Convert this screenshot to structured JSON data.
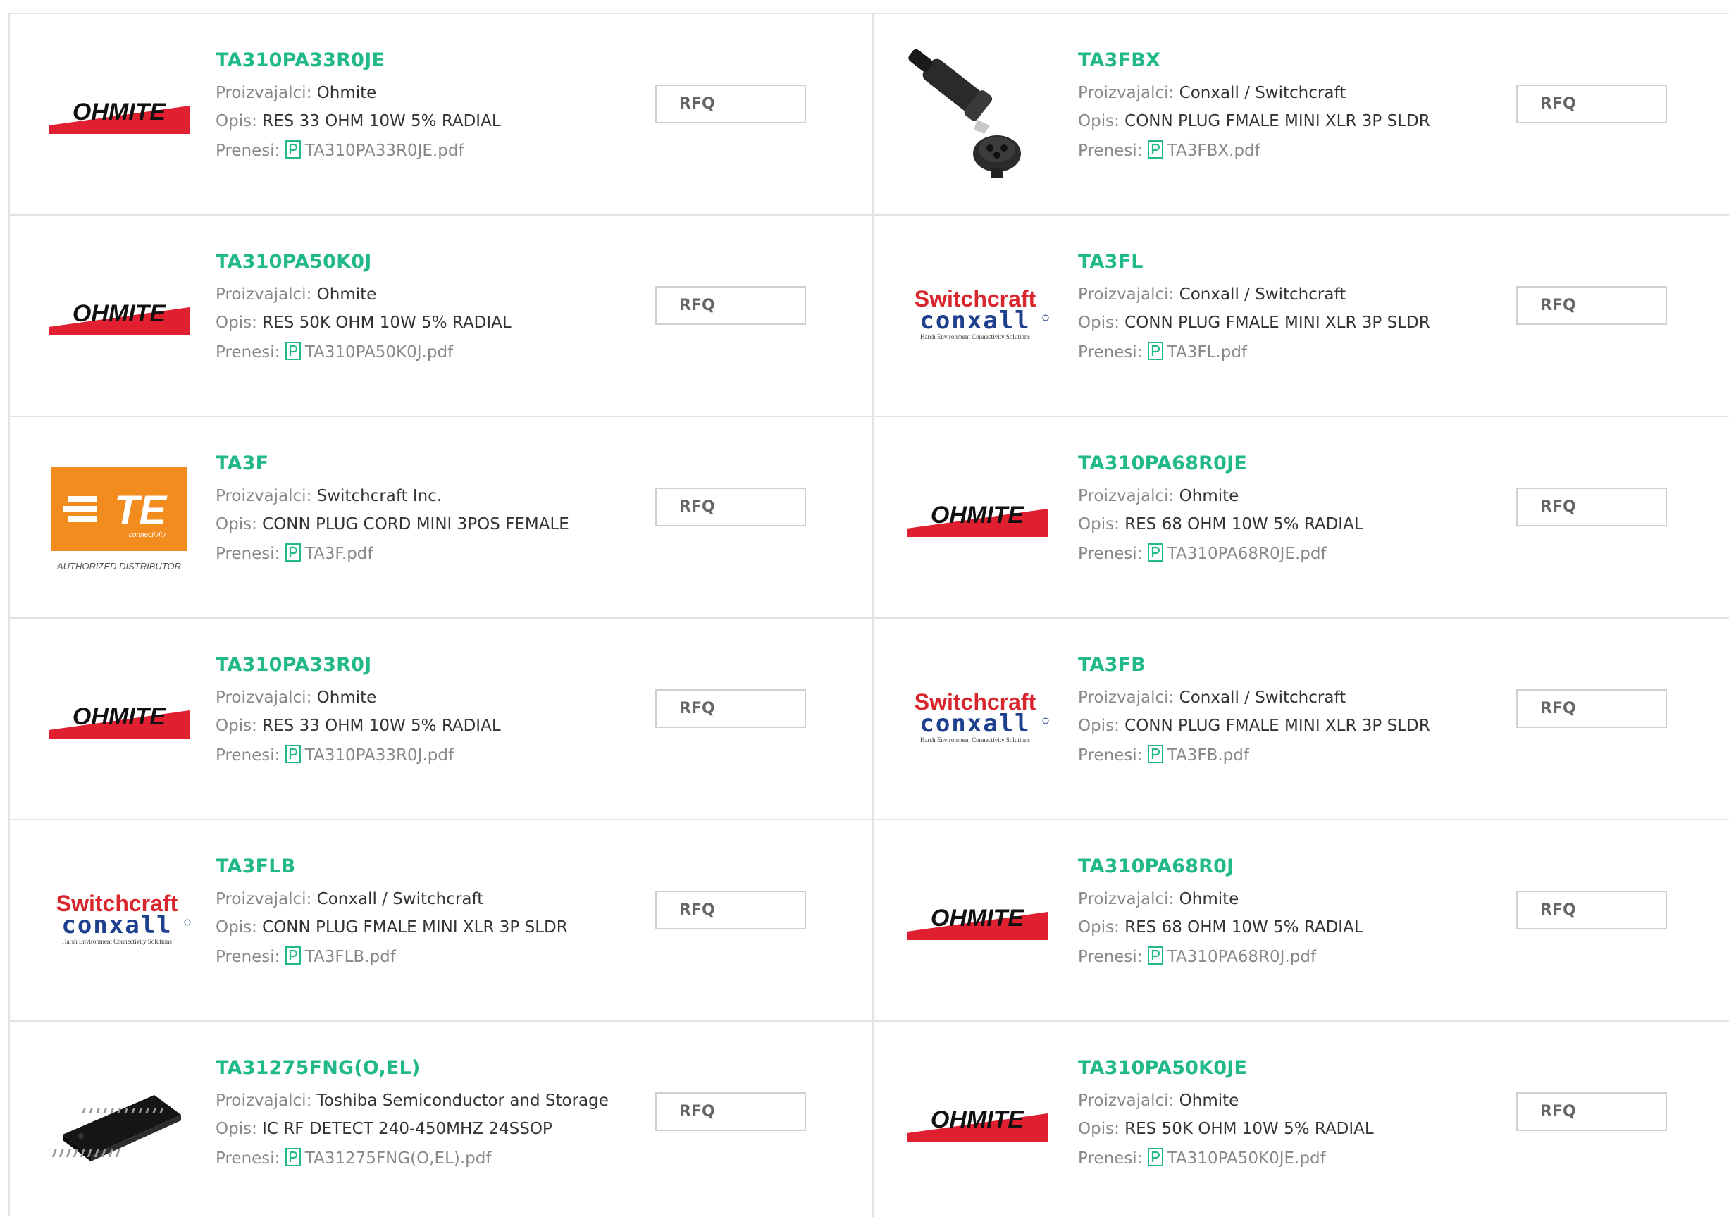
{
  "labels": {
    "manufacturer": "Proizvajalci:",
    "description": "Opis:",
    "download": "Prenesi:",
    "rfq": "RFQ"
  },
  "logo_text": {
    "ohmite": "OHMITE",
    "te": "TE",
    "te_sub": "connectivity",
    "te_auth": "AUTHORIZED DISTRIBUTOR",
    "switchcraft": "Switchcraft",
    "conxall": "conxall",
    "conxall_sub": "Harsh Environment Connectivity Solutions"
  },
  "colors": {
    "accent": "#21b88a",
    "ohmite_red": "#e02030",
    "te_orange": "#f28c1e",
    "switchcraft_red": "#d9262c",
    "conxall_blue": "#1f3f8f"
  },
  "products": [
    {
      "pn": "TA310PA33R0JE",
      "mfr": "Ohmite",
      "desc": "RES 33 OHM 10W 5% RADIAL",
      "pdf": "TA310PA33R0JE.pdf",
      "logo": "ohmite"
    },
    {
      "pn": "TA3FBX",
      "mfr": "Conxall / Switchcraft",
      "desc": "CONN PLUG FMALE MINI XLR 3P SLDR",
      "pdf": "TA3FBX.pdf",
      "logo": "xlr-photo"
    },
    {
      "pn": "TA310PA50K0J",
      "mfr": "Ohmite",
      "desc": "RES 50K OHM 10W 5% RADIAL",
      "pdf": "TA310PA50K0J.pdf",
      "logo": "ohmite"
    },
    {
      "pn": "TA3FL",
      "mfr": "Conxall / Switchcraft",
      "desc": "CONN PLUG FMALE MINI XLR 3P SLDR",
      "pdf": "TA3FL.pdf",
      "logo": "switchcraft"
    },
    {
      "pn": "TA3F",
      "mfr": "Switchcraft Inc.",
      "desc": "CONN PLUG CORD MINI 3POS FEMALE",
      "pdf": "TA3F.pdf",
      "logo": "te"
    },
    {
      "pn": "TA310PA68R0JE",
      "mfr": "Ohmite",
      "desc": "RES 68 OHM 10W 5% RADIAL",
      "pdf": "TA310PA68R0JE.pdf",
      "logo": "ohmite"
    },
    {
      "pn": "TA310PA33R0J",
      "mfr": "Ohmite",
      "desc": "RES 33 OHM 10W 5% RADIAL",
      "pdf": "TA310PA33R0J.pdf",
      "logo": "ohmite"
    },
    {
      "pn": "TA3FB",
      "mfr": "Conxall / Switchcraft",
      "desc": "CONN PLUG FMALE MINI XLR 3P SLDR",
      "pdf": "TA3FB.pdf",
      "logo": "switchcraft"
    },
    {
      "pn": "TA3FLB",
      "mfr": "Conxall / Switchcraft",
      "desc": "CONN PLUG FMALE MINI XLR 3P SLDR",
      "pdf": "TA3FLB.pdf",
      "logo": "switchcraft"
    },
    {
      "pn": "TA310PA68R0J",
      "mfr": "Ohmite",
      "desc": "RES 68 OHM 10W 5% RADIAL",
      "pdf": "TA310PA68R0J.pdf",
      "logo": "ohmite"
    },
    {
      "pn": "TA31275FNG(O,EL)",
      "mfr": "Toshiba Semiconductor and Storage",
      "desc": "IC RF DETECT 240-450MHZ 24SSOP",
      "pdf": "TA31275FNG(O,EL).pdf",
      "logo": "ic-photo"
    },
    {
      "pn": "TA310PA50K0JE",
      "mfr": "Ohmite",
      "desc": "RES 50K OHM 10W 5% RADIAL",
      "pdf": "TA310PA50K0JE.pdf",
      "logo": "ohmite"
    }
  ]
}
